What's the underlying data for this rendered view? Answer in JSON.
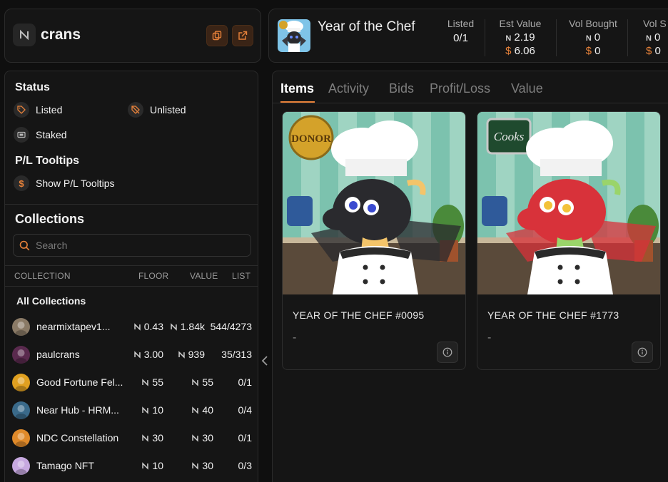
{
  "profile": {
    "name": "crans"
  },
  "header": {
    "title": "Year of the Chef",
    "stats": [
      {
        "label": "Listed",
        "value": "0/1",
        "usd": ""
      },
      {
        "label": "Est Value",
        "value": "2.19",
        "usd": "6.06"
      },
      {
        "label": "Vol Bought",
        "value": "0",
        "usd": "0"
      },
      {
        "label": "Vol S",
        "value": "0",
        "usd": "0"
      }
    ]
  },
  "sidebar": {
    "status_title": "Status",
    "status_options": [
      "Listed",
      "Unlisted",
      "Staked"
    ],
    "pl_title": "P/L Tooltips",
    "pl_option": "Show P/L Tooltips",
    "collections_title": "Collections",
    "search_placeholder": "Search",
    "columns": [
      "COLLECTION",
      "FLOOR",
      "VALUE",
      "LIST"
    ],
    "all_collections": "All Collections",
    "collections": [
      {
        "name": "nearmixtapev1...",
        "floor": "0.43",
        "value": "1.84k",
        "list": "544/4273",
        "color": "#8a7a66"
      },
      {
        "name": "paulcrans",
        "floor": "3.00",
        "value": "939",
        "list": "35/313",
        "color": "#5a2a4e"
      },
      {
        "name": "Good Fortune Fel...",
        "floor": "55",
        "value": "55",
        "list": "0/1",
        "color": "#e0a020"
      },
      {
        "name": "Near Hub - HRM...",
        "floor": "10",
        "value": "40",
        "list": "0/4",
        "color": "#3a6a8a"
      },
      {
        "name": "NDC Constellation",
        "floor": "30",
        "value": "30",
        "list": "0/1",
        "color": "#e08a2a"
      },
      {
        "name": "Tamago NFT",
        "floor": "10",
        "value": "30",
        "list": "0/3",
        "color": "#c7a9e0"
      }
    ]
  },
  "main": {
    "tabs": [
      "Items",
      "Activity",
      "Bids",
      "Profit/Loss",
      "Value"
    ],
    "active_tab": "Items",
    "items": [
      {
        "title": "YEAR OF THE CHEF #0095",
        "price": "-",
        "sign": "DONOR",
        "dragon_color": "#2a2a2e",
        "accent": "#f3c46a"
      },
      {
        "title": "YEAR OF THE CHEF #1773",
        "price": "-",
        "sign": "Cooks",
        "dragon_color": "#d8323a",
        "accent": "#9ad46a"
      }
    ]
  },
  "colors": {
    "accent": "#e8823a",
    "bg": "#0f0f0f",
    "panel": "#151515"
  }
}
